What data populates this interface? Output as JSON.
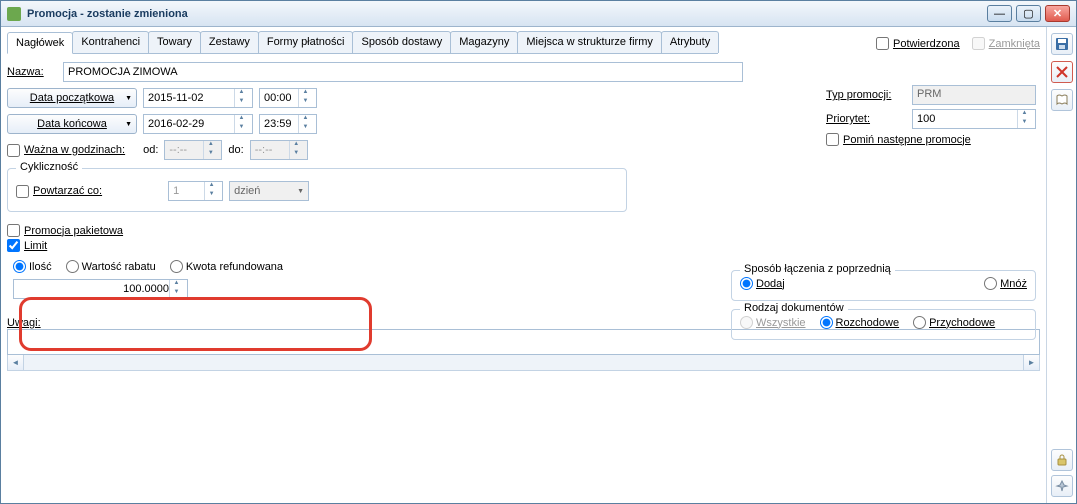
{
  "window": {
    "title": "Promocja - zostanie zmieniona"
  },
  "tabs": [
    "Nagłówek",
    "Kontrahenci",
    "Towary",
    "Zestawy",
    "Formy płatności",
    "Sposób dostawy",
    "Magazyny",
    "Miejsca w strukturze firmy",
    "Atrybuty"
  ],
  "checks": {
    "potwierdzona": "Potwierdzona",
    "zamknieta": "Zamknięta"
  },
  "nazwa": {
    "label": "Nazwa:",
    "value": "PROMOCJA ZIMOWA"
  },
  "dates": {
    "start_btn": "Data początkowa",
    "end_btn": "Data końcowa",
    "start_date": "2015-11-02",
    "start_time": "00:00",
    "end_date": "2016-02-29",
    "end_time": "23:59"
  },
  "wazna": {
    "label": "Ważna w godzinach:",
    "od": "od:",
    "do": "do:",
    "ph": "--:--"
  },
  "cykl": {
    "title": "Cykliczność",
    "label": "Powtarzać co:",
    "value": "1",
    "unit": "dzień"
  },
  "pakiet": "Promocja pakietowa",
  "limit": "Limit",
  "limit_type": {
    "ilosc": "Ilość",
    "wartosc": "Wartość rabatu",
    "kwota": "Kwota refundowana",
    "value": "100.0000"
  },
  "right": {
    "typ_label": "Typ promocji:",
    "typ_value": "PRM",
    "prio_label": "Priorytet:",
    "prio_value": "100",
    "pomin": "Pomiń następne promocje"
  },
  "laczenie": {
    "title": "Sposób łączenia z poprzednią",
    "dodaj": "Dodaj",
    "mnoz": "Mnóż"
  },
  "rodzaj": {
    "title": "Rodzaj dokumentów",
    "wszystkie": "Wszystkie",
    "rozchodowe": "Rozchodowe",
    "przychodowe": "Przychodowe"
  },
  "uwagi": "Uwagi:"
}
